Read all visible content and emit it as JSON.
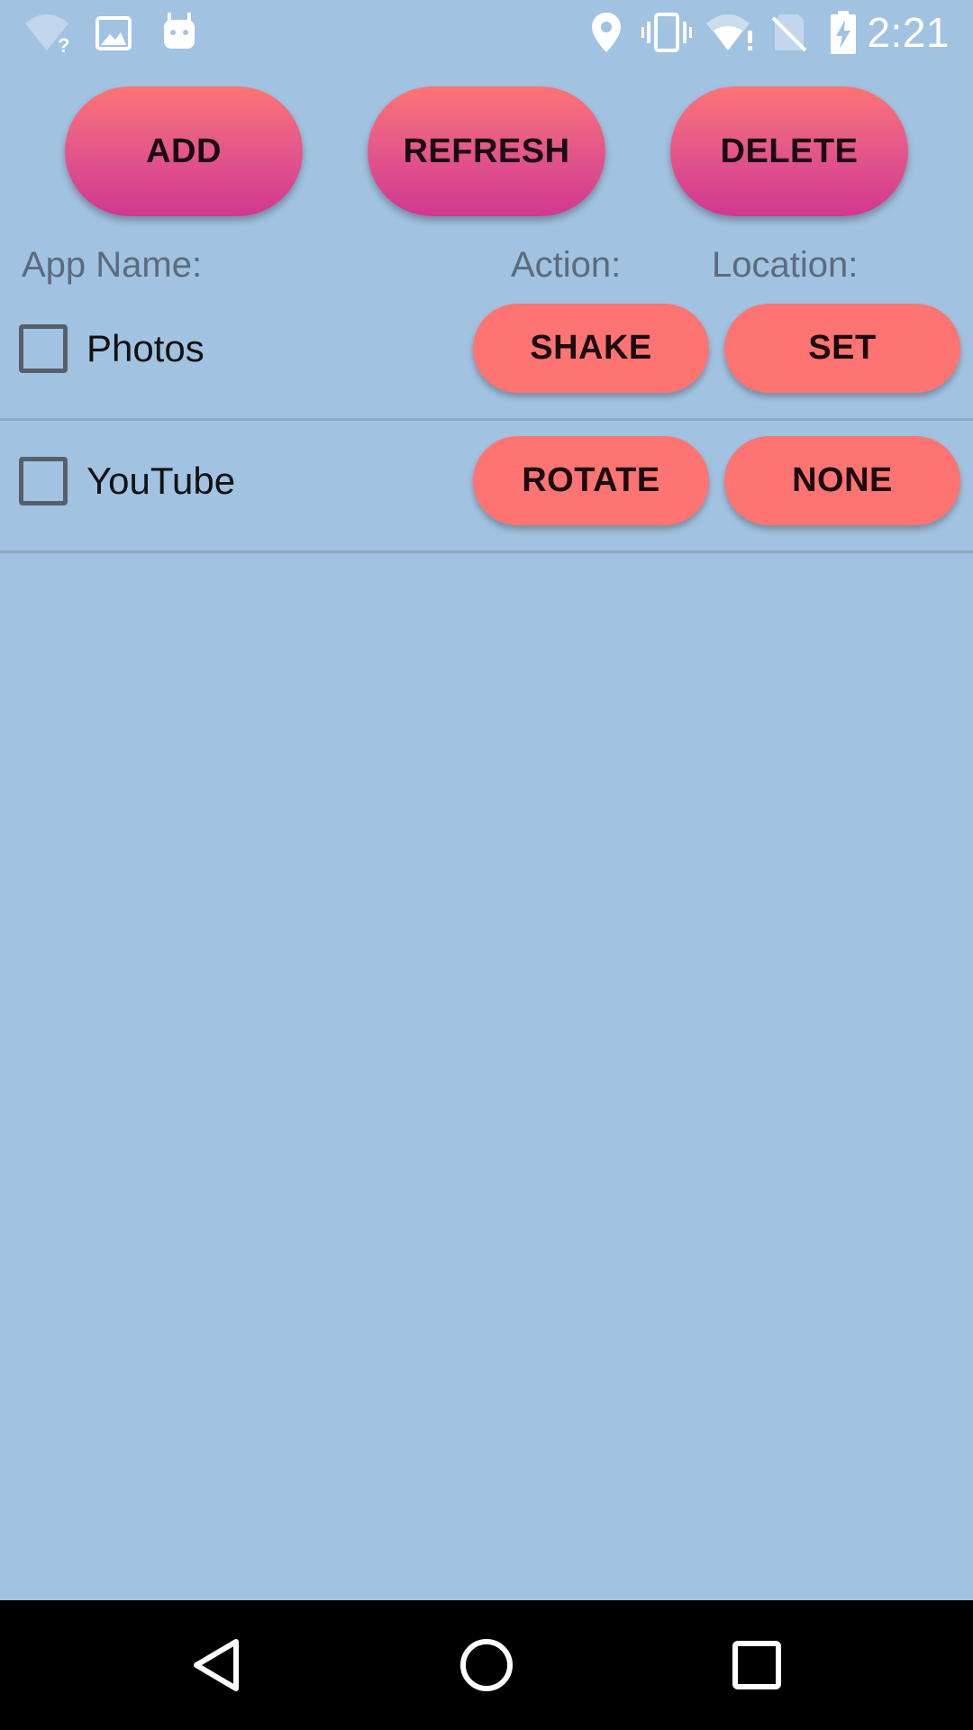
{
  "status_bar": {
    "time": "2:21",
    "icons_left": [
      "wifi-unknown-icon",
      "image-icon",
      "android-icon"
    ],
    "icons_right": [
      "location-icon",
      "vibrate-icon",
      "wifi-alert-icon",
      "no-sim-icon",
      "battery-charging-icon"
    ]
  },
  "toolbar": {
    "add_label": "ADD",
    "refresh_label": "REFRESH",
    "delete_label": "DELETE"
  },
  "headers": {
    "app_name": "App Name:",
    "action": "Action:",
    "location": "Location:"
  },
  "rows": [
    {
      "app": "Photos",
      "action": "SHAKE",
      "location": "SET",
      "checked": false
    },
    {
      "app": "YouTube",
      "action": "ROTATE",
      "location": "NONE",
      "checked": false
    }
  ],
  "nav": {
    "icons": [
      "back-icon",
      "home-icon",
      "recents-icon"
    ]
  },
  "colors": {
    "background": "#a2c2e1",
    "top_button_gradient": [
      "#fd7474",
      "#d1388f"
    ],
    "row_button": "#fe7472",
    "nav_bar": "#000000"
  }
}
